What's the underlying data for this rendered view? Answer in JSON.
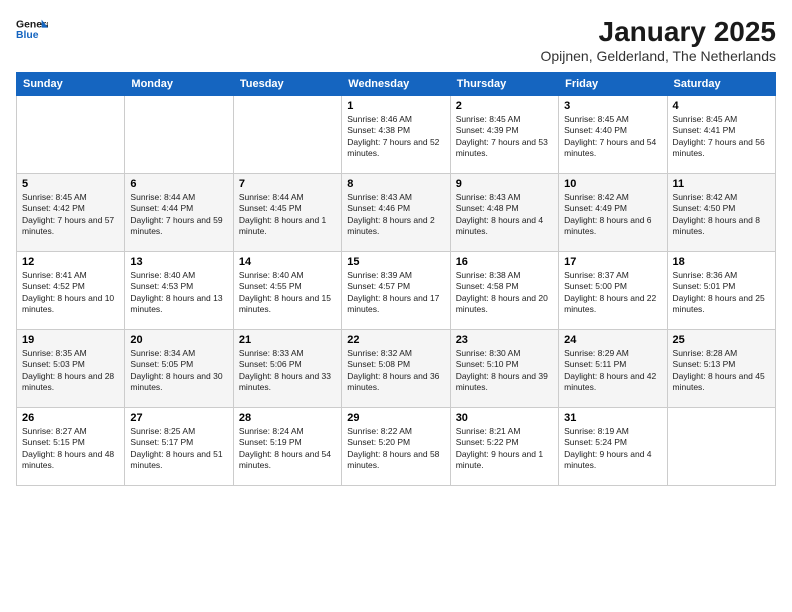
{
  "logo": {
    "line1": "General",
    "line2": "Blue"
  },
  "title": {
    "month_year": "January 2025",
    "location": "Opijnen, Gelderland, The Netherlands"
  },
  "days_of_week": [
    "Sunday",
    "Monday",
    "Tuesday",
    "Wednesday",
    "Thursday",
    "Friday",
    "Saturday"
  ],
  "weeks": [
    [
      {
        "date": "",
        "info": ""
      },
      {
        "date": "",
        "info": ""
      },
      {
        "date": "",
        "info": ""
      },
      {
        "date": "1",
        "info": "Sunrise: 8:46 AM\nSunset: 4:38 PM\nDaylight: 7 hours and 52 minutes."
      },
      {
        "date": "2",
        "info": "Sunrise: 8:45 AM\nSunset: 4:39 PM\nDaylight: 7 hours and 53 minutes."
      },
      {
        "date": "3",
        "info": "Sunrise: 8:45 AM\nSunset: 4:40 PM\nDaylight: 7 hours and 54 minutes."
      },
      {
        "date": "4",
        "info": "Sunrise: 8:45 AM\nSunset: 4:41 PM\nDaylight: 7 hours and 56 minutes."
      }
    ],
    [
      {
        "date": "5",
        "info": "Sunrise: 8:45 AM\nSunset: 4:42 PM\nDaylight: 7 hours and 57 minutes."
      },
      {
        "date": "6",
        "info": "Sunrise: 8:44 AM\nSunset: 4:44 PM\nDaylight: 7 hours and 59 minutes."
      },
      {
        "date": "7",
        "info": "Sunrise: 8:44 AM\nSunset: 4:45 PM\nDaylight: 8 hours and 1 minute."
      },
      {
        "date": "8",
        "info": "Sunrise: 8:43 AM\nSunset: 4:46 PM\nDaylight: 8 hours and 2 minutes."
      },
      {
        "date": "9",
        "info": "Sunrise: 8:43 AM\nSunset: 4:48 PM\nDaylight: 8 hours and 4 minutes."
      },
      {
        "date": "10",
        "info": "Sunrise: 8:42 AM\nSunset: 4:49 PM\nDaylight: 8 hours and 6 minutes."
      },
      {
        "date": "11",
        "info": "Sunrise: 8:42 AM\nSunset: 4:50 PM\nDaylight: 8 hours and 8 minutes."
      }
    ],
    [
      {
        "date": "12",
        "info": "Sunrise: 8:41 AM\nSunset: 4:52 PM\nDaylight: 8 hours and 10 minutes."
      },
      {
        "date": "13",
        "info": "Sunrise: 8:40 AM\nSunset: 4:53 PM\nDaylight: 8 hours and 13 minutes."
      },
      {
        "date": "14",
        "info": "Sunrise: 8:40 AM\nSunset: 4:55 PM\nDaylight: 8 hours and 15 minutes."
      },
      {
        "date": "15",
        "info": "Sunrise: 8:39 AM\nSunset: 4:57 PM\nDaylight: 8 hours and 17 minutes."
      },
      {
        "date": "16",
        "info": "Sunrise: 8:38 AM\nSunset: 4:58 PM\nDaylight: 8 hours and 20 minutes."
      },
      {
        "date": "17",
        "info": "Sunrise: 8:37 AM\nSunset: 5:00 PM\nDaylight: 8 hours and 22 minutes."
      },
      {
        "date": "18",
        "info": "Sunrise: 8:36 AM\nSunset: 5:01 PM\nDaylight: 8 hours and 25 minutes."
      }
    ],
    [
      {
        "date": "19",
        "info": "Sunrise: 8:35 AM\nSunset: 5:03 PM\nDaylight: 8 hours and 28 minutes."
      },
      {
        "date": "20",
        "info": "Sunrise: 8:34 AM\nSunset: 5:05 PM\nDaylight: 8 hours and 30 minutes."
      },
      {
        "date": "21",
        "info": "Sunrise: 8:33 AM\nSunset: 5:06 PM\nDaylight: 8 hours and 33 minutes."
      },
      {
        "date": "22",
        "info": "Sunrise: 8:32 AM\nSunset: 5:08 PM\nDaylight: 8 hours and 36 minutes."
      },
      {
        "date": "23",
        "info": "Sunrise: 8:30 AM\nSunset: 5:10 PM\nDaylight: 8 hours and 39 minutes."
      },
      {
        "date": "24",
        "info": "Sunrise: 8:29 AM\nSunset: 5:11 PM\nDaylight: 8 hours and 42 minutes."
      },
      {
        "date": "25",
        "info": "Sunrise: 8:28 AM\nSunset: 5:13 PM\nDaylight: 8 hours and 45 minutes."
      }
    ],
    [
      {
        "date": "26",
        "info": "Sunrise: 8:27 AM\nSunset: 5:15 PM\nDaylight: 8 hours and 48 minutes."
      },
      {
        "date": "27",
        "info": "Sunrise: 8:25 AM\nSunset: 5:17 PM\nDaylight: 8 hours and 51 minutes."
      },
      {
        "date": "28",
        "info": "Sunrise: 8:24 AM\nSunset: 5:19 PM\nDaylight: 8 hours and 54 minutes."
      },
      {
        "date": "29",
        "info": "Sunrise: 8:22 AM\nSunset: 5:20 PM\nDaylight: 8 hours and 58 minutes."
      },
      {
        "date": "30",
        "info": "Sunrise: 8:21 AM\nSunset: 5:22 PM\nDaylight: 9 hours and 1 minute."
      },
      {
        "date": "31",
        "info": "Sunrise: 8:19 AM\nSunset: 5:24 PM\nDaylight: 9 hours and 4 minutes."
      },
      {
        "date": "",
        "info": ""
      }
    ]
  ]
}
